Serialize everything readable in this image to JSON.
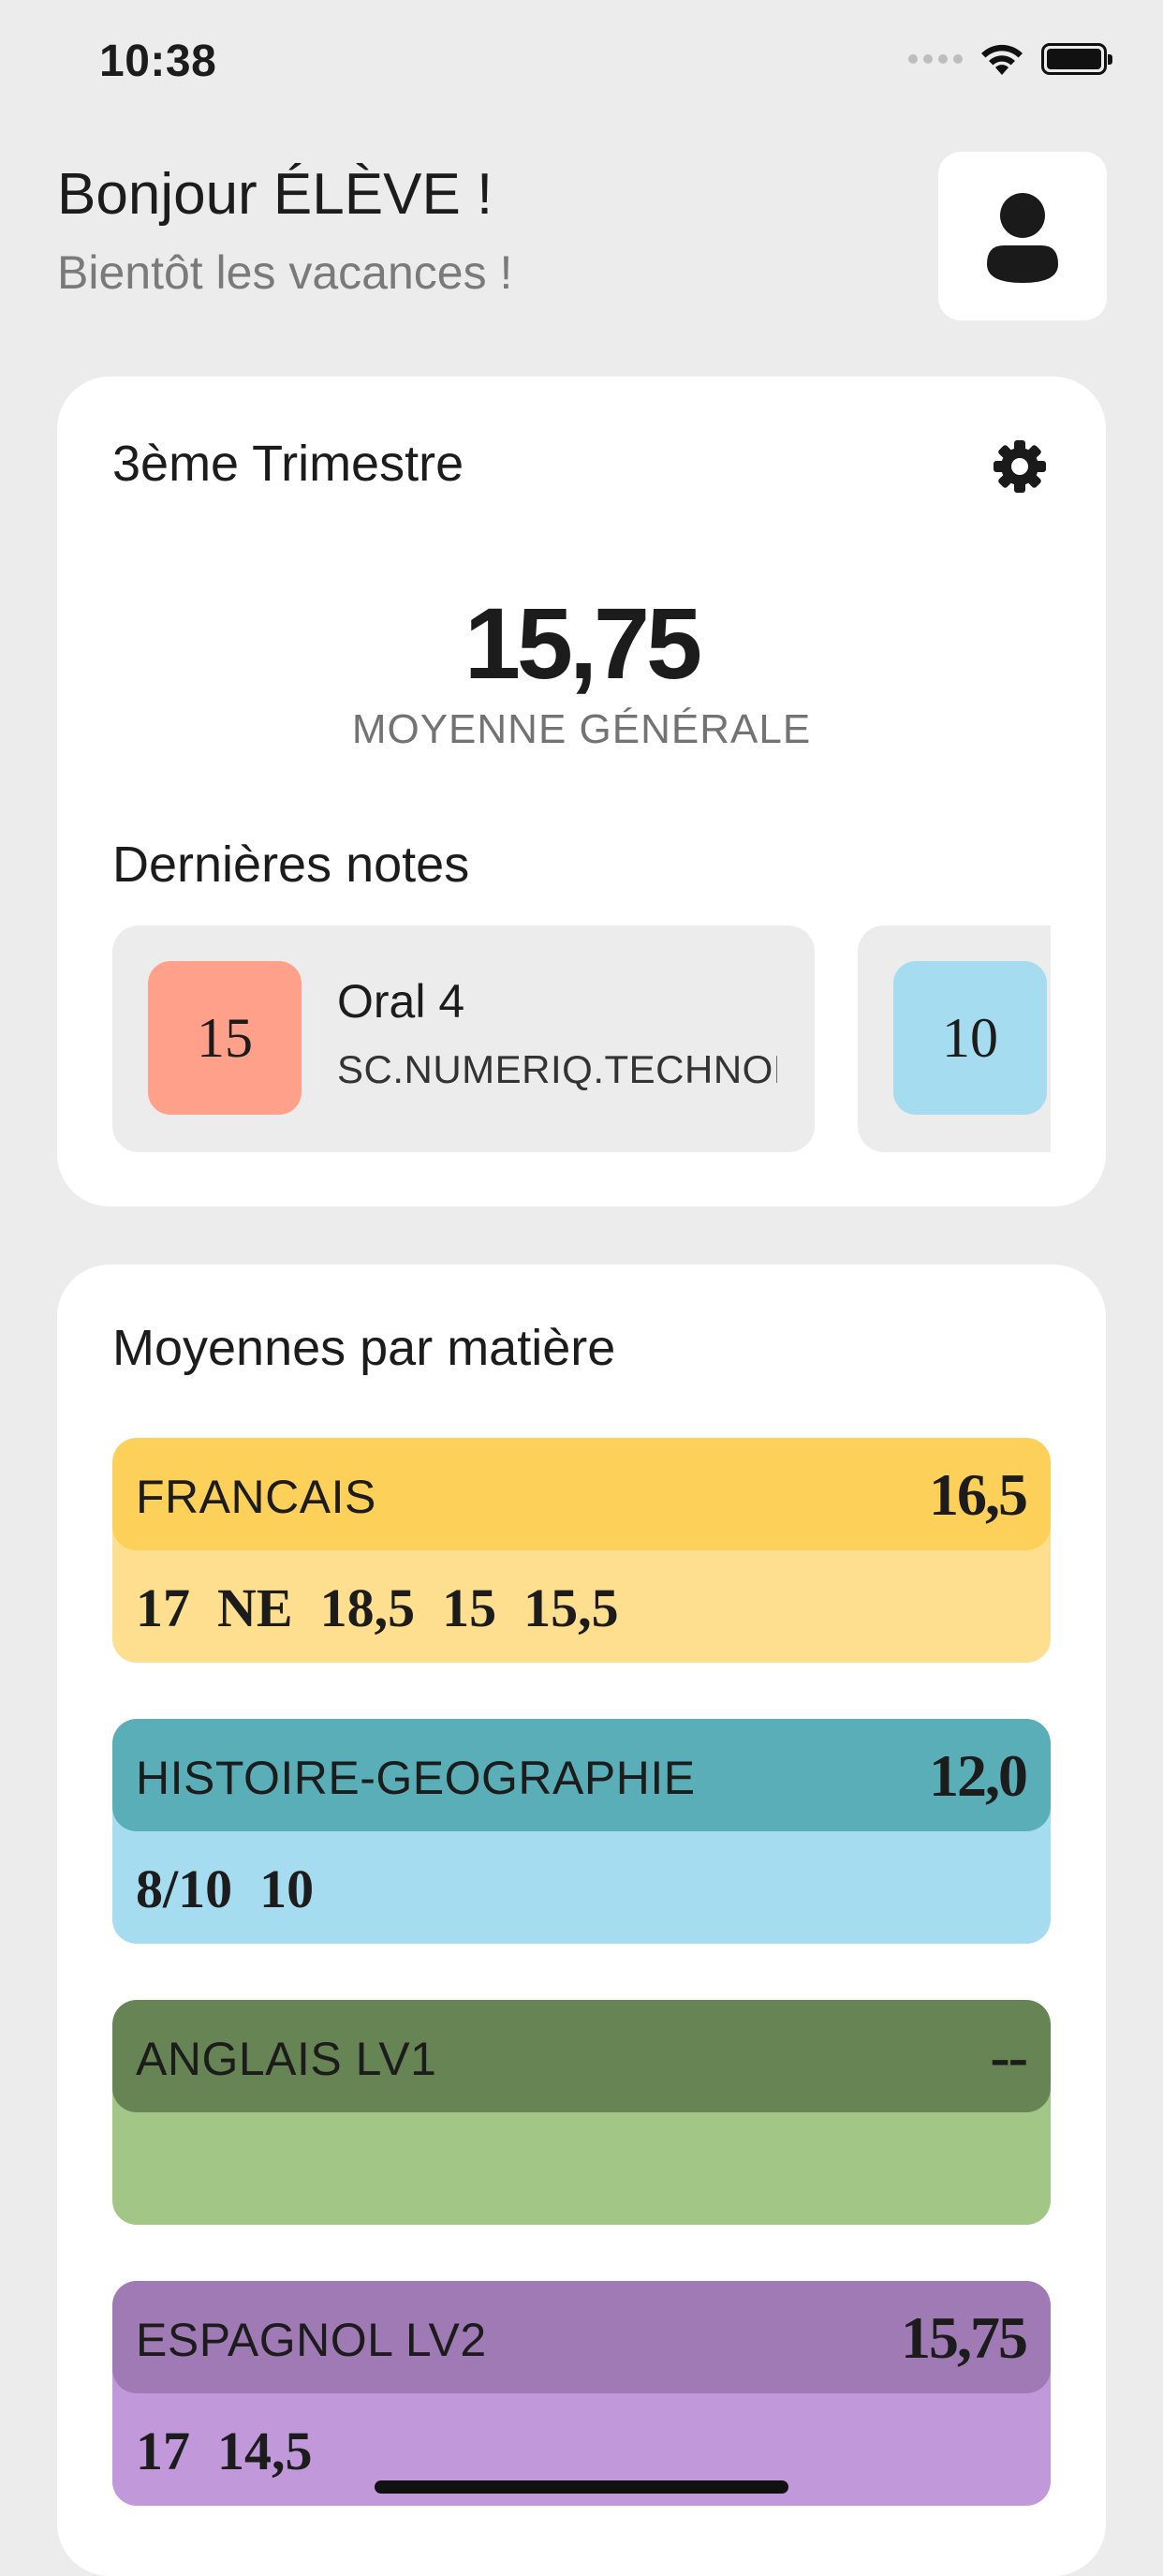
{
  "status_bar": {
    "time": "10:38",
    "icons": [
      "signal-icon",
      "wifi-icon",
      "battery-icon"
    ]
  },
  "header": {
    "greeting": "Bonjour ÉLÈVE !",
    "subtitle": "Bientôt les vacances !",
    "profile_icon": "user-icon"
  },
  "summary": {
    "term": "3ème Trimestre",
    "settings_icon": "gear-icon",
    "average": "15,75",
    "average_label": "MOYENNE GÉNÉRALE",
    "recent_title": "Dernières notes",
    "recent_grades": [
      {
        "grade": "15",
        "name": "Oral 4",
        "subject": "SC.NUMERIQ.TECHNOL",
        "color": "#fea08a"
      },
      {
        "grade": "10",
        "name": "",
        "subject": "",
        "color": "#a5dcf0"
      }
    ]
  },
  "subjects": {
    "title": "Moyennes par matière",
    "items": [
      {
        "name": "FRANCAIS",
        "average": "16,5",
        "grades": "17  NE  18,5  15  15,5",
        "head_color": "#fdd05a",
        "body_color": "#fedf8f"
      },
      {
        "name": "HISTOIRE-GEOGRAPHIE",
        "average": "12,0",
        "grades": "8/10  10",
        "head_color": "#5aaeb8",
        "body_color": "#a5dcf0"
      },
      {
        "name": "ANGLAIS LV1",
        "average": "--",
        "grades": "",
        "head_color": "#678454",
        "body_color": "#a2c685"
      },
      {
        "name": "ESPAGNOL LV2",
        "average": "15,75",
        "grades": "17  14,5",
        "head_color": "#a07ab5",
        "body_color": "#c198da"
      }
    ]
  }
}
